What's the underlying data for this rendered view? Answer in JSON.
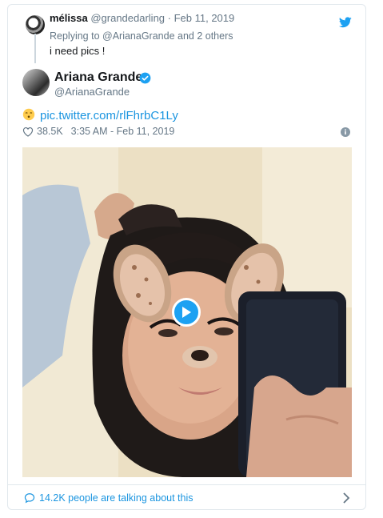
{
  "reply": {
    "name": "mélissa",
    "handle": "@grandedarling",
    "separator": " · ",
    "date": "Feb 11, 2019",
    "replying_to": "Replying to @ArianaGrande and 2 others",
    "text": "i need pics !"
  },
  "tweet": {
    "name": "Ariana Grande",
    "handle": "@ArianaGrande",
    "link": "pic.twitter.com/rlFhrbC1Ly",
    "likes": "38.5K",
    "time": "3:35 AM - Feb 11, 2019"
  },
  "footer": {
    "talking": "14.2K people are talking about this"
  },
  "colors": {
    "accent": "#1da1f2",
    "link": "#1b95e0",
    "muted": "#657786",
    "border": "#e1e8ed"
  },
  "icons": [
    "twitter-bird-icon",
    "verified-badge-icon",
    "emoji-icon",
    "heart-icon",
    "info-icon",
    "play-icon",
    "speech-bubble-icon",
    "chevron-right-icon"
  ]
}
